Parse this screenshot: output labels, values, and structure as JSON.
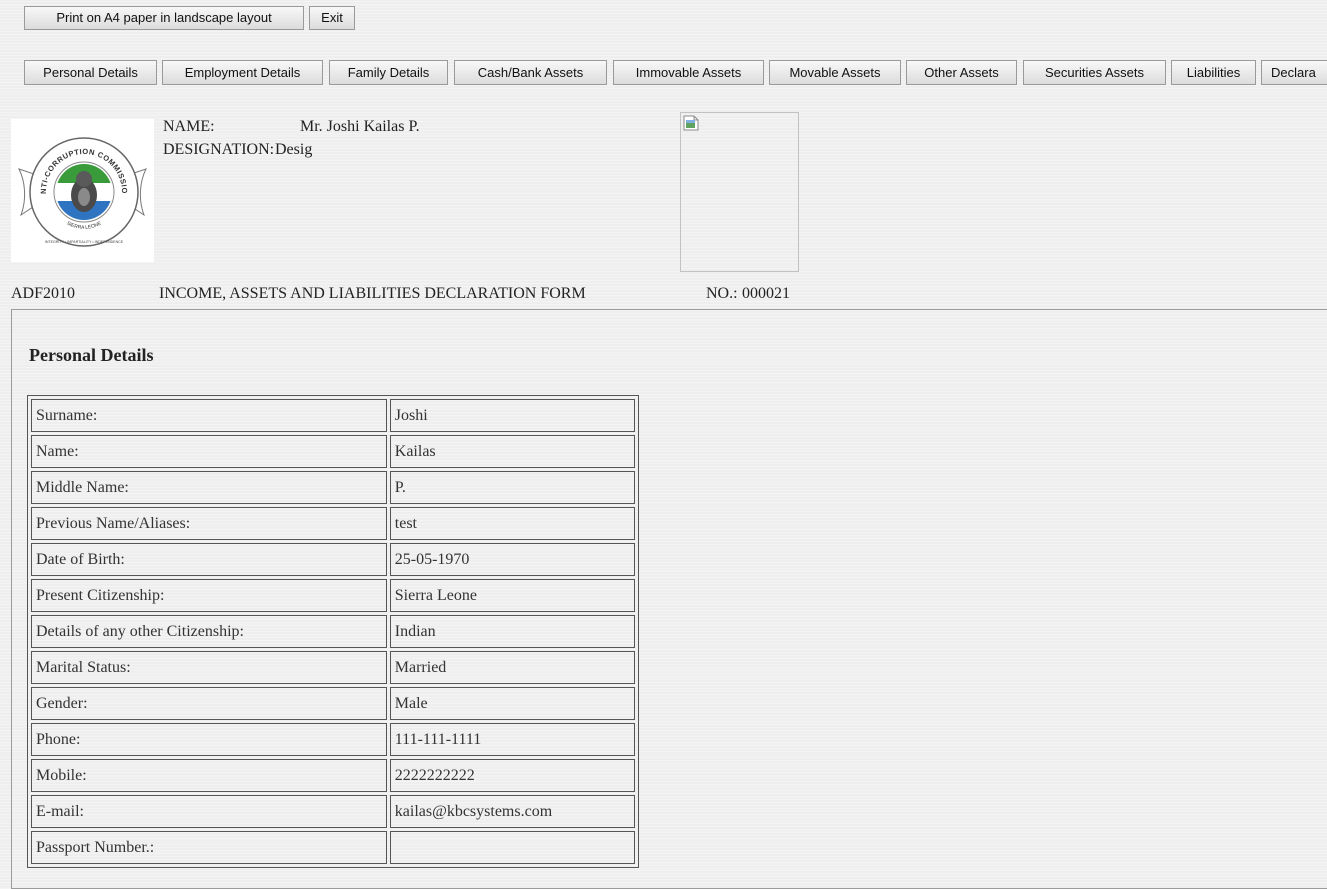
{
  "toolbar": {
    "print_label": "Print on A4 paper in landscape layout",
    "exit_label": "Exit"
  },
  "tabs": [
    {
      "label": "Personal Details"
    },
    {
      "label": "Employment Details"
    },
    {
      "label": "Family Details"
    },
    {
      "label": "Cash/Bank Assets"
    },
    {
      "label": "Immovable Assets"
    },
    {
      "label": "Movable Assets"
    },
    {
      "label": "Other Assets"
    },
    {
      "label": "Securities Assets"
    },
    {
      "label": "Liabilities"
    },
    {
      "label": "Declara"
    }
  ],
  "header": {
    "logo": {
      "ring_text": "ANTI-CORRUPTION COMMISSION",
      "country_text": "SIERRA LEONE",
      "motto_text": "INTEGRITY • IMPARTIALITY • INDEPENDENCE",
      "flag_colors": [
        "#3a9b3a",
        "#ffffff",
        "#2f74c0"
      ]
    },
    "name_label": "NAME:",
    "name_value": "Mr. Joshi Kailas P.",
    "designation_label": "DESIGNATION:",
    "designation_value": "Desig"
  },
  "form": {
    "code": "ADF2010",
    "title": "INCOME, ASSETS AND LIABILITIES DECLARATION FORM",
    "number_label": "NO.:",
    "number_value": "000021"
  },
  "section": {
    "title": "Personal Details",
    "rows": [
      {
        "label": "Surname:",
        "value": "Joshi"
      },
      {
        "label": "Name:",
        "value": "Kailas"
      },
      {
        "label": "Middle Name:",
        "value": "P."
      },
      {
        "label": "Previous Name/Aliases:",
        "value": "test"
      },
      {
        "label": "Date of Birth:",
        "value": "25-05-1970"
      },
      {
        "label": "Present Citizenship:",
        "value": "Sierra Leone"
      },
      {
        "label": "Details of any other Citizenship:",
        "value": "Indian"
      },
      {
        "label": "Marital Status:",
        "value": "Married"
      },
      {
        "label": "Gender:",
        "value": "Male"
      },
      {
        "label": "Phone:",
        "value": "111-111-1111"
      },
      {
        "label": "Mobile:",
        "value": "2222222222"
      },
      {
        "label": "E-mail:",
        "value": "kailas@kbcsystems.com"
      },
      {
        "label": "Passport Number.:",
        "value": ""
      }
    ]
  }
}
